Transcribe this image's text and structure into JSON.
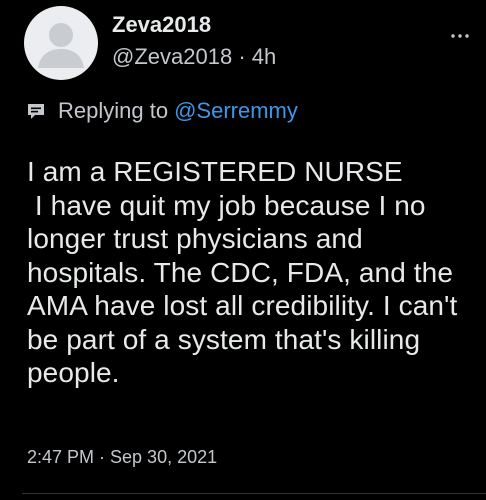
{
  "author": {
    "display_name": "Zeva2018",
    "handle": "@Zeva2018",
    "separator": "·",
    "time_ago": "4h"
  },
  "reply": {
    "prefix": "Replying to",
    "mention": "@Serremmy",
    "icon": "speech-bubble-icon"
  },
  "tweet": {
    "text": "I am a REGISTERED NURSE\n I have quit my job because I no longer trust physicians and hospitals. The CDC, FDA, and the AMA have lost all credibility. I can't be part of a system that's killing people.",
    "timestamp": "2:47 PM · Sep 30, 2021"
  },
  "icons": {
    "more": "more-options-icon",
    "avatar": "default-avatar-icon"
  },
  "colors": {
    "background": "#000000",
    "text_primary": "#e7e9ea",
    "text_secondary": "#c4c7cc",
    "accent": "#3b97e8"
  }
}
